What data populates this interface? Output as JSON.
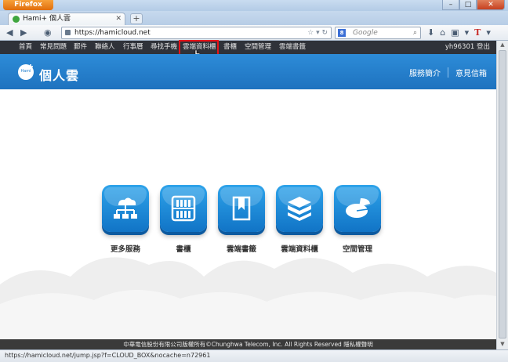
{
  "browser": {
    "app_button": "Firefox",
    "tab_title": "Hami+ 個人雲",
    "url": "https://hamicloud.net",
    "search_placeholder": "Google",
    "search_engine_letter": "8",
    "win_minimize": "–",
    "win_maximize": "□",
    "win_close": "✕"
  },
  "sitemenu": {
    "items": [
      "首頁",
      "常見問題",
      "郵件",
      "聯絡人",
      "行事曆",
      "尋找手機",
      "雲端資料櫃",
      "書櫃",
      "空間管理",
      "雲端書籤"
    ],
    "user": "yh96301 登出",
    "highlight_color": "#e8131a"
  },
  "header": {
    "logo_badge": "Hami",
    "logo_text": "個人雲",
    "links": [
      "服務簡介",
      "意見信箱"
    ],
    "color": "#2582cf"
  },
  "apps": [
    {
      "label": "更多服務",
      "icon": "cloud-network-icon"
    },
    {
      "label": "書櫃",
      "icon": "bookshelf-icon"
    },
    {
      "label": "雲端書籤",
      "icon": "bookmark-icon"
    },
    {
      "label": "雲端資料櫃",
      "icon": "storage-box-icon"
    },
    {
      "label": "空間管理",
      "icon": "pie-chart-icon"
    }
  ],
  "footer": {
    "text": "中華電信股份有限公司版權所有©Chunghwa Telecom, Inc. All Rights Reserved 隱私權聲明"
  },
  "statusbar": {
    "text": "https://hamicloud.net/jump.jsp?f=CLOUD_BOX&nocache=n72961"
  }
}
